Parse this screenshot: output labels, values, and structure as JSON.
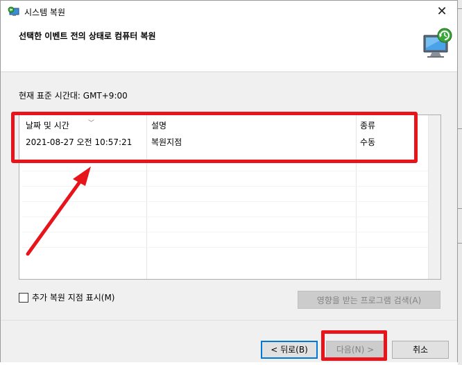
{
  "window": {
    "title": "시스템 복원",
    "close_glyph": "✕"
  },
  "header": {
    "title": "선택한 이벤트 전의 상태로 컴퓨터 복원",
    "icon": "system-restore-icon"
  },
  "timezone_label": "현재 표준 시간대: GMT+9:00",
  "list": {
    "columns": [
      "날짜 및 시간",
      "설명",
      "종류"
    ],
    "rows": [
      {
        "date": "2021-08-27 오전 10:57:21",
        "description": "복원지점",
        "type": "수동"
      }
    ]
  },
  "show_more_checkbox": {
    "label": "추가 복원 지점 표시(M)",
    "checked": false
  },
  "scan_button": {
    "label": "영향을 받는 프로그램 검색(A)",
    "enabled": false
  },
  "buttons": {
    "back": "< 뒤로(B)",
    "next": "다음(N) >",
    "cancel": "취소"
  },
  "colors": {
    "highlight": "#e8141b",
    "focus": "#0078d7"
  }
}
